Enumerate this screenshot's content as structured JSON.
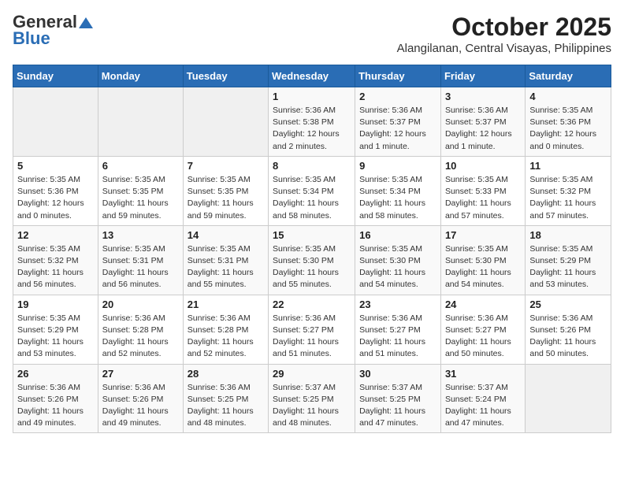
{
  "header": {
    "logo_general": "General",
    "logo_blue": "Blue",
    "month_title": "October 2025",
    "location": "Alangilanan, Central Visayas, Philippines"
  },
  "days_of_week": [
    "Sunday",
    "Monday",
    "Tuesday",
    "Wednesday",
    "Thursday",
    "Friday",
    "Saturday"
  ],
  "weeks": [
    [
      {
        "day": "",
        "info": ""
      },
      {
        "day": "",
        "info": ""
      },
      {
        "day": "",
        "info": ""
      },
      {
        "day": "1",
        "info": "Sunrise: 5:36 AM\nSunset: 5:38 PM\nDaylight: 12 hours\nand 2 minutes."
      },
      {
        "day": "2",
        "info": "Sunrise: 5:36 AM\nSunset: 5:37 PM\nDaylight: 12 hours\nand 1 minute."
      },
      {
        "day": "3",
        "info": "Sunrise: 5:36 AM\nSunset: 5:37 PM\nDaylight: 12 hours\nand 1 minute."
      },
      {
        "day": "4",
        "info": "Sunrise: 5:35 AM\nSunset: 5:36 PM\nDaylight: 12 hours\nand 0 minutes."
      }
    ],
    [
      {
        "day": "5",
        "info": "Sunrise: 5:35 AM\nSunset: 5:36 PM\nDaylight: 12 hours\nand 0 minutes."
      },
      {
        "day": "6",
        "info": "Sunrise: 5:35 AM\nSunset: 5:35 PM\nDaylight: 11 hours\nand 59 minutes."
      },
      {
        "day": "7",
        "info": "Sunrise: 5:35 AM\nSunset: 5:35 PM\nDaylight: 11 hours\nand 59 minutes."
      },
      {
        "day": "8",
        "info": "Sunrise: 5:35 AM\nSunset: 5:34 PM\nDaylight: 11 hours\nand 58 minutes."
      },
      {
        "day": "9",
        "info": "Sunrise: 5:35 AM\nSunset: 5:34 PM\nDaylight: 11 hours\nand 58 minutes."
      },
      {
        "day": "10",
        "info": "Sunrise: 5:35 AM\nSunset: 5:33 PM\nDaylight: 11 hours\nand 57 minutes."
      },
      {
        "day": "11",
        "info": "Sunrise: 5:35 AM\nSunset: 5:32 PM\nDaylight: 11 hours\nand 57 minutes."
      }
    ],
    [
      {
        "day": "12",
        "info": "Sunrise: 5:35 AM\nSunset: 5:32 PM\nDaylight: 11 hours\nand 56 minutes."
      },
      {
        "day": "13",
        "info": "Sunrise: 5:35 AM\nSunset: 5:31 PM\nDaylight: 11 hours\nand 56 minutes."
      },
      {
        "day": "14",
        "info": "Sunrise: 5:35 AM\nSunset: 5:31 PM\nDaylight: 11 hours\nand 55 minutes."
      },
      {
        "day": "15",
        "info": "Sunrise: 5:35 AM\nSunset: 5:30 PM\nDaylight: 11 hours\nand 55 minutes."
      },
      {
        "day": "16",
        "info": "Sunrise: 5:35 AM\nSunset: 5:30 PM\nDaylight: 11 hours\nand 54 minutes."
      },
      {
        "day": "17",
        "info": "Sunrise: 5:35 AM\nSunset: 5:30 PM\nDaylight: 11 hours\nand 54 minutes."
      },
      {
        "day": "18",
        "info": "Sunrise: 5:35 AM\nSunset: 5:29 PM\nDaylight: 11 hours\nand 53 minutes."
      }
    ],
    [
      {
        "day": "19",
        "info": "Sunrise: 5:35 AM\nSunset: 5:29 PM\nDaylight: 11 hours\nand 53 minutes."
      },
      {
        "day": "20",
        "info": "Sunrise: 5:36 AM\nSunset: 5:28 PM\nDaylight: 11 hours\nand 52 minutes."
      },
      {
        "day": "21",
        "info": "Sunrise: 5:36 AM\nSunset: 5:28 PM\nDaylight: 11 hours\nand 52 minutes."
      },
      {
        "day": "22",
        "info": "Sunrise: 5:36 AM\nSunset: 5:27 PM\nDaylight: 11 hours\nand 51 minutes."
      },
      {
        "day": "23",
        "info": "Sunrise: 5:36 AM\nSunset: 5:27 PM\nDaylight: 11 hours\nand 51 minutes."
      },
      {
        "day": "24",
        "info": "Sunrise: 5:36 AM\nSunset: 5:27 PM\nDaylight: 11 hours\nand 50 minutes."
      },
      {
        "day": "25",
        "info": "Sunrise: 5:36 AM\nSunset: 5:26 PM\nDaylight: 11 hours\nand 50 minutes."
      }
    ],
    [
      {
        "day": "26",
        "info": "Sunrise: 5:36 AM\nSunset: 5:26 PM\nDaylight: 11 hours\nand 49 minutes."
      },
      {
        "day": "27",
        "info": "Sunrise: 5:36 AM\nSunset: 5:26 PM\nDaylight: 11 hours\nand 49 minutes."
      },
      {
        "day": "28",
        "info": "Sunrise: 5:36 AM\nSunset: 5:25 PM\nDaylight: 11 hours\nand 48 minutes."
      },
      {
        "day": "29",
        "info": "Sunrise: 5:37 AM\nSunset: 5:25 PM\nDaylight: 11 hours\nand 48 minutes."
      },
      {
        "day": "30",
        "info": "Sunrise: 5:37 AM\nSunset: 5:25 PM\nDaylight: 11 hours\nand 47 minutes."
      },
      {
        "day": "31",
        "info": "Sunrise: 5:37 AM\nSunset: 5:24 PM\nDaylight: 11 hours\nand 47 minutes."
      },
      {
        "day": "",
        "info": ""
      }
    ]
  ]
}
